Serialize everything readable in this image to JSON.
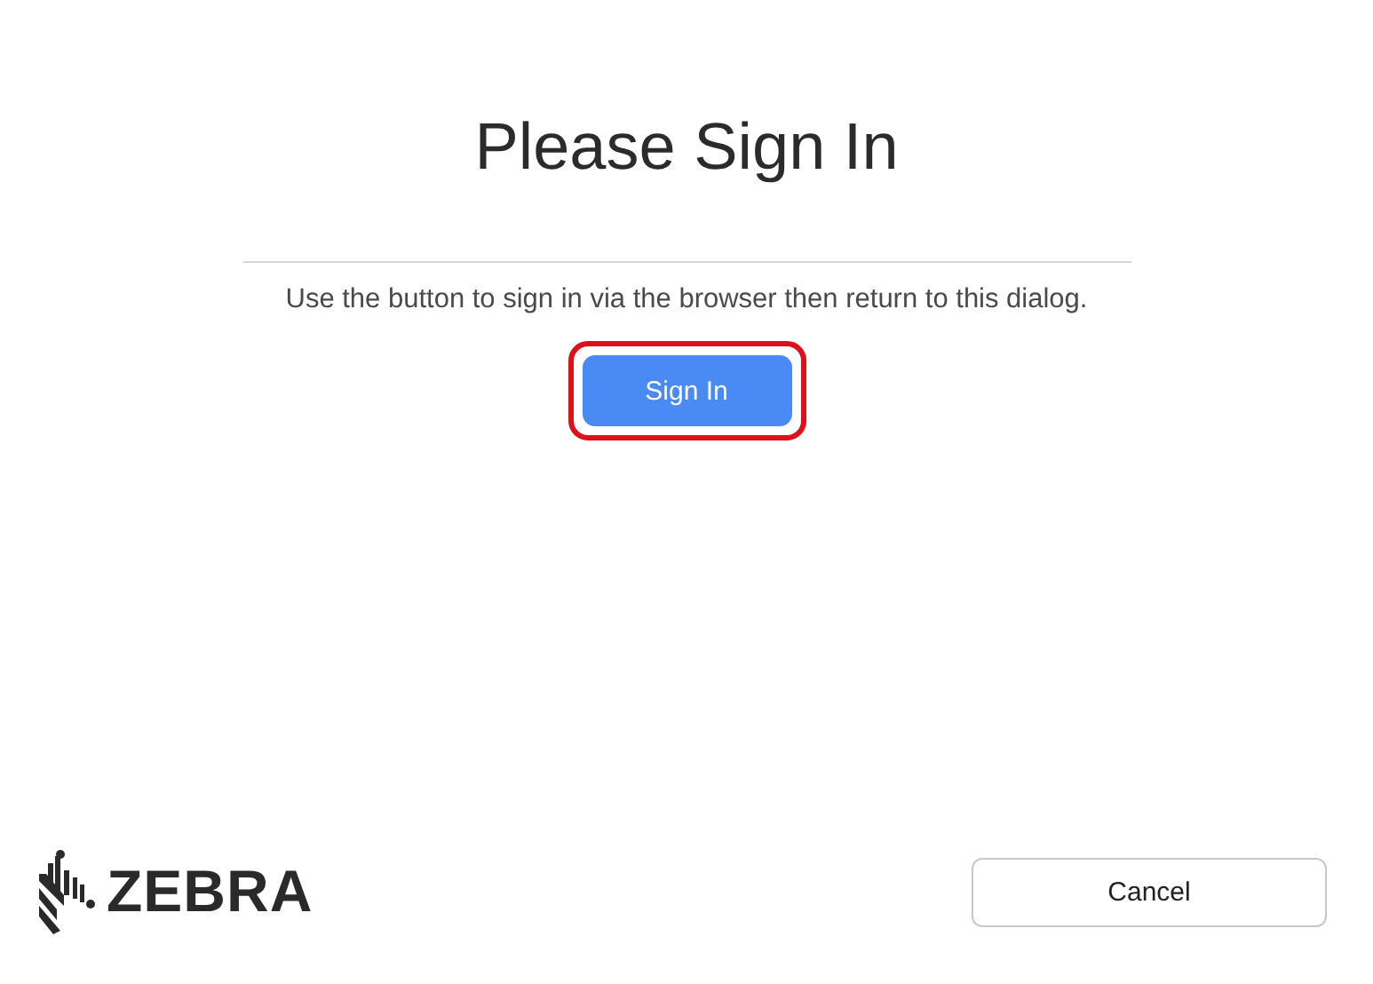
{
  "title": "Please Sign In",
  "instructions": "Use the button to sign in via the browser then return to this dialog.",
  "sign_in_button": {
    "label": "Sign In",
    "highlighted": true
  },
  "logo": {
    "text": "ZEBRA"
  },
  "cancel_button": {
    "label": "Cancel"
  }
}
